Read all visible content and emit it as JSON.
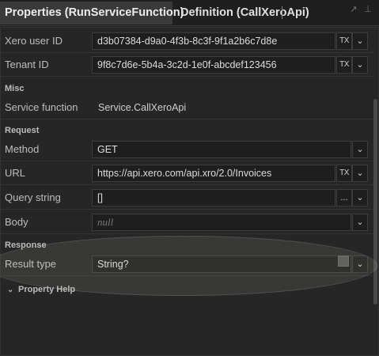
{
  "tabs": [
    {
      "label": "Properties (RunServiceFunction)"
    },
    {
      "label": "Definition (CallXeroApi)"
    }
  ],
  "window_icons": {
    "pin": "↗",
    "dock": "⊥"
  },
  "properties": {
    "xero_user_id": {
      "label": "Xero user ID",
      "value": "d3b07384-d9a0-4f3b-8c3f-9f1a2b6c7d8e"
    },
    "tenant_id": {
      "label": "Tenant ID",
      "value": "9f8c7d6e-5b4a-3c2d-1e0f-abcdef123456"
    }
  },
  "misc": {
    "section_label": "Misc",
    "service_function": {
      "label": "Service function",
      "value": "Service.CallXeroApi"
    }
  },
  "request": {
    "section_label": "Request",
    "method": {
      "label": "Method",
      "value": "GET"
    },
    "url": {
      "label": "URL",
      "value": "https://api.xero.com/api.xro/2.0/Invoices"
    },
    "query_string": {
      "label": "Query string",
      "value": "[]"
    },
    "body": {
      "label": "Body",
      "placeholder": "null"
    }
  },
  "response": {
    "section_label": "Response",
    "result_type": {
      "label": "Result type",
      "value": "String?",
      "checked": true
    }
  },
  "buttons": {
    "tx": "TX",
    "ellipsis": "...",
    "chevron": "⌄"
  },
  "help": {
    "label": "Property Help",
    "chevron": "⌄"
  }
}
